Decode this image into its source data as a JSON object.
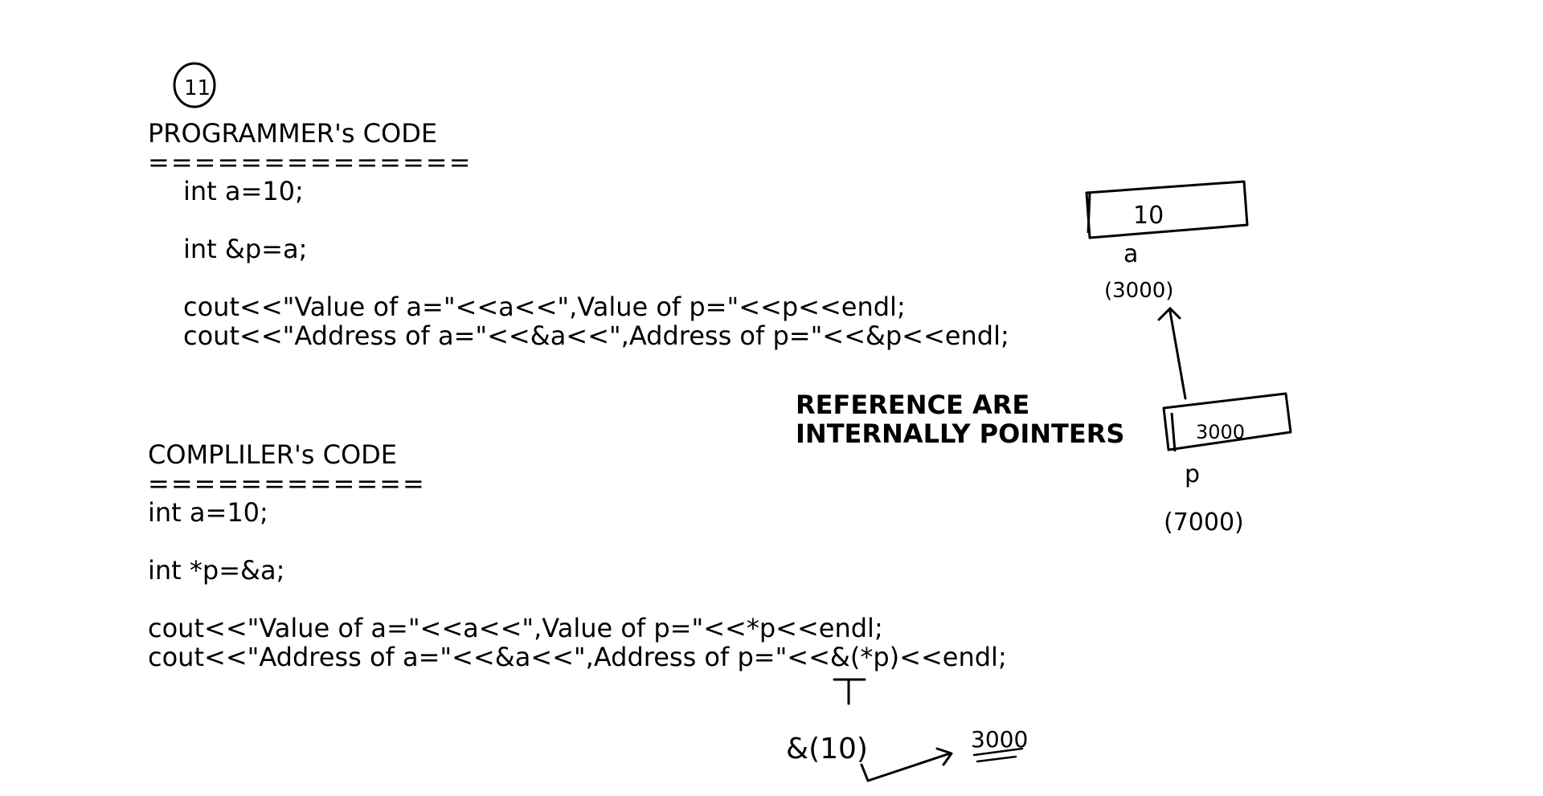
{
  "note_number": "11",
  "programmer": {
    "heading": "PROGRAMMER's CODE",
    "separator": "==============",
    "lines": [
      "int a=10;",
      "int &p=a;",
      "cout<<\"Value of a=\"<<a<<\",Value of p=\"<<p<<endl;",
      "cout<<\"Address of a=\"<<&a<<\",Address of p=\"<<&p<<endl;"
    ]
  },
  "compiler": {
    "heading": "COMPLILER's CODE",
    "separator": "============",
    "lines": [
      "int a=10;",
      "int *p=&a;",
      "cout<<\"Value of a=\"<<a<<\",Value of p=\"<<*p<<endl;",
      "cout<<\"Address of a=\"<<&a<<\",Address of p=\"<<&(*p)<<endl;"
    ]
  },
  "callout": {
    "line1": "REFERENCE ARE",
    "line2": "INTERNALLY POINTERS"
  },
  "diagram": {
    "box_a_value": "10",
    "label_a": "a",
    "addr_a": "(3000)",
    "box_p_value": "3000",
    "label_p": "p",
    "addr_p": "(7000)"
  },
  "annotation": {
    "deref_value": "&(10)",
    "result": "3000"
  }
}
